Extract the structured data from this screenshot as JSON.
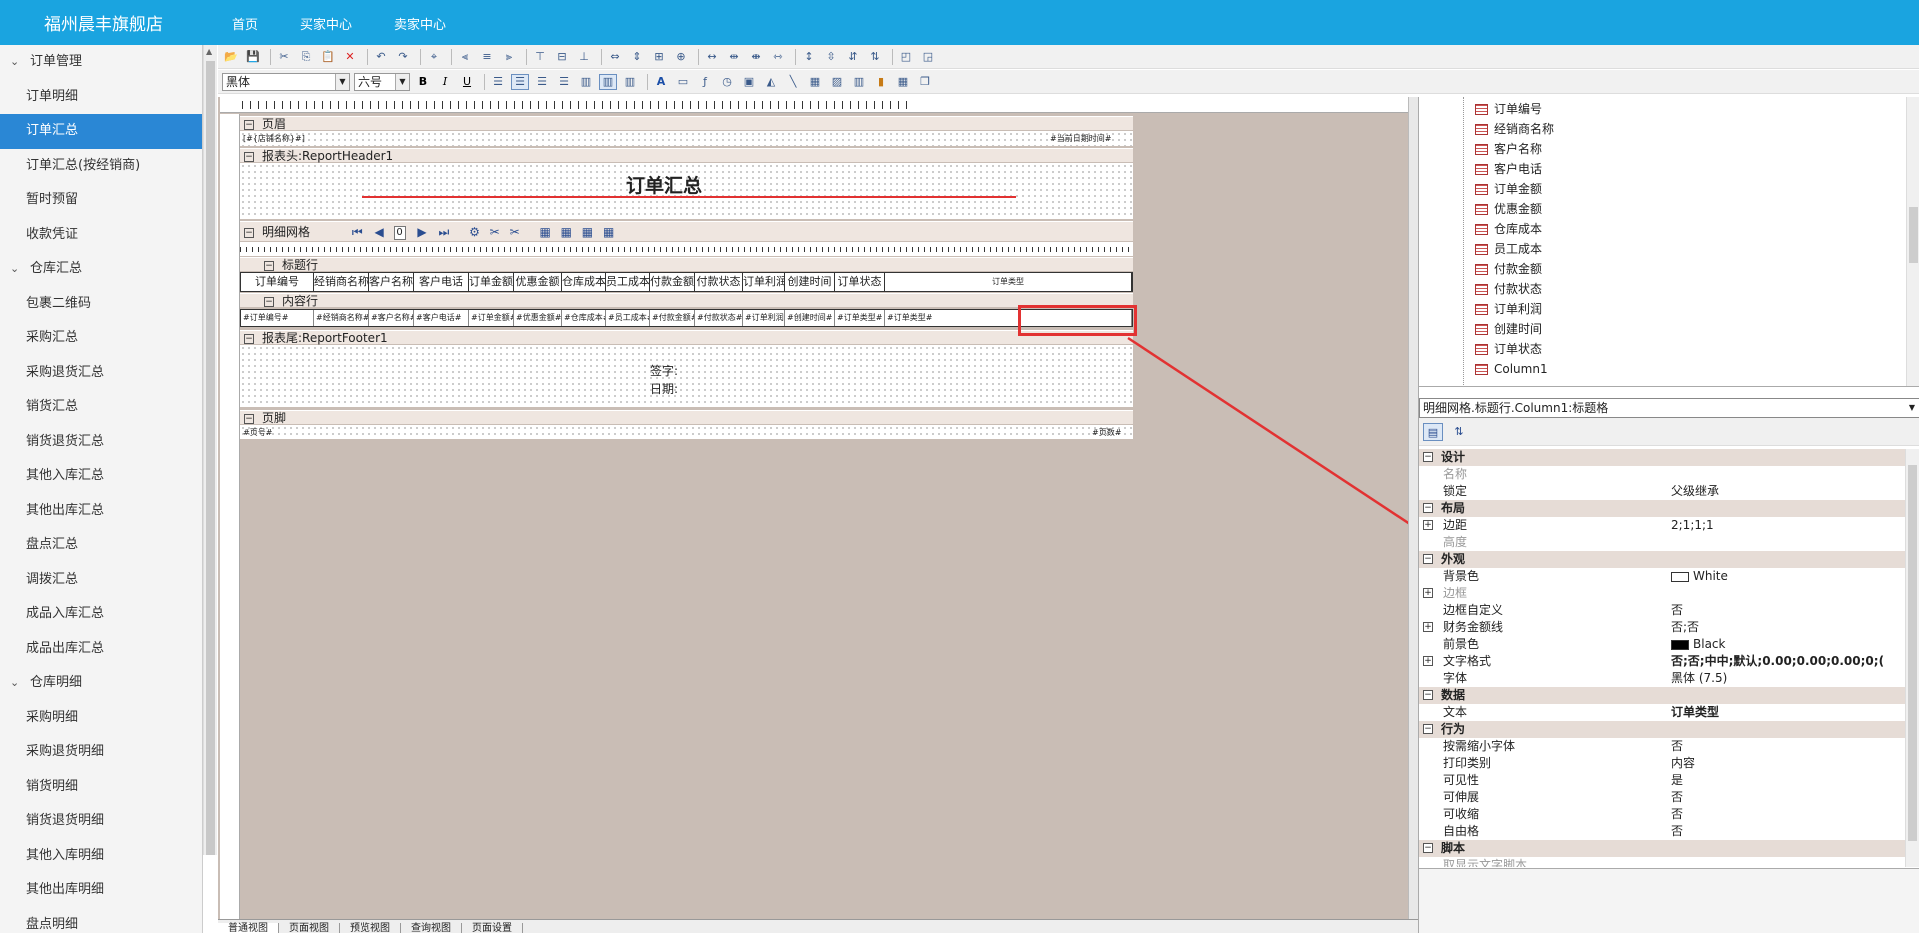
{
  "header": {
    "brand": "福州晨丰旗舰店",
    "nav": [
      "首页",
      "买家中心",
      "卖家中心"
    ]
  },
  "sidebar": {
    "items": [
      {
        "label": "订单管理",
        "group": true
      },
      {
        "label": "订单明细"
      },
      {
        "label": "订单汇总",
        "active": true
      },
      {
        "label": "订单汇总(按经销商)"
      },
      {
        "label": "暂时预留"
      },
      {
        "label": "收款凭证"
      },
      {
        "label": "仓库汇总",
        "group": true
      },
      {
        "label": "包裹二维码"
      },
      {
        "label": "采购汇总"
      },
      {
        "label": "采购退货汇总"
      },
      {
        "label": "销货汇总"
      },
      {
        "label": "销货退货汇总"
      },
      {
        "label": "其他入库汇总"
      },
      {
        "label": "其他出库汇总"
      },
      {
        "label": "盘点汇总"
      },
      {
        "label": "调拨汇总"
      },
      {
        "label": "成品入库汇总"
      },
      {
        "label": "成品出库汇总"
      },
      {
        "label": "仓库明细",
        "group": true
      },
      {
        "label": "采购明细"
      },
      {
        "label": "采购退货明细"
      },
      {
        "label": "销货明细"
      },
      {
        "label": "销货退货明细"
      },
      {
        "label": "其他入库明细"
      },
      {
        "label": "其他出库明细"
      },
      {
        "label": "盘点明细"
      }
    ]
  },
  "toolbar": {
    "font_name": "黑体",
    "font_size": "六号"
  },
  "report": {
    "page_header_label": "页眉",
    "store_field": "[#{店铺名称}#]",
    "date_field": "#当前日期时间#",
    "report_header_label": "报表头:ReportHeader1",
    "title": "订单汇总",
    "detail_grid_label": "明细网格",
    "nav_page": "0",
    "title_row_label": "标题行",
    "content_row_label": "内容行",
    "report_footer_label": "报表尾:ReportFooter1",
    "sign_label": "签字:",
    "date_label": "日期:",
    "page_footer_label": "页脚",
    "page_no_field": "#页号#",
    "page_count_field": "#页数#",
    "columns": [
      "订单编号",
      "经销商名称",
      "客户名称",
      "客户电话",
      "订单金额",
      "优惠金额",
      "仓库成本",
      "员工成本",
      "付款金额",
      "付款状态",
      "订单利润",
      "创建时间",
      "订单状态",
      "订单类型"
    ],
    "cells": [
      "#订单编号#",
      "#经销商名称#",
      "#客户名称#",
      "#客户电话#",
      "#订单金额#",
      "#优惠金额#",
      "#仓库成本#",
      "#员工成本#",
      "#付款金额#",
      "#付款状态#",
      "#订单利润#",
      "#创建时间#",
      "#订单类型#",
      "#订单类型#"
    ]
  },
  "tree": {
    "items": [
      "订单编号",
      "经销商名称",
      "客户名称",
      "客户电话",
      "订单金额",
      "优惠金额",
      "仓库成本",
      "员工成本",
      "付款金额",
      "付款状态",
      "订单利润",
      "创建时间",
      "订单状态",
      "Column1"
    ]
  },
  "properties": {
    "object_selector": "明细网格.标题行.Column1:标题格",
    "rows": [
      {
        "key": "设计",
        "cat": true
      },
      {
        "key": "名称",
        "val": "",
        "dim": true
      },
      {
        "key": "锁定",
        "val": "父级继承"
      },
      {
        "key": "布局",
        "cat": true
      },
      {
        "key": "边距",
        "val": "2;1;1;1",
        "expand": true
      },
      {
        "key": "高度",
        "val": "",
        "dim": true
      },
      {
        "key": "外观",
        "cat": true
      },
      {
        "key": "背景色",
        "val": "White",
        "swatch": "#ffffff"
      },
      {
        "key": "边框",
        "val": "",
        "expand": true,
        "dim": true
      },
      {
        "key": "边框自定义",
        "val": "否"
      },
      {
        "key": "财务金额线",
        "val": "否;否",
        "expand": true
      },
      {
        "key": "前景色",
        "val": "Black",
        "swatch": "#000000"
      },
      {
        "key": "文字格式",
        "val": "否;否;中中;默认;0.00;0.00;0.00;0;(",
        "expand": true,
        "bold": true
      },
      {
        "key": "字体",
        "val": "黑体 (7.5)"
      },
      {
        "key": "数据",
        "cat": true
      },
      {
        "key": "文本",
        "val": "订单类型",
        "bold": true
      },
      {
        "key": "行为",
        "cat": true
      },
      {
        "key": "按需缩小字体",
        "val": "否"
      },
      {
        "key": "打印类别",
        "val": "内容"
      },
      {
        "key": "可见性",
        "val": "是"
      },
      {
        "key": "可伸展",
        "val": "否"
      },
      {
        "key": "可收缩",
        "val": "否"
      },
      {
        "key": "自由格",
        "val": "否"
      },
      {
        "key": "脚本",
        "cat": true
      },
      {
        "key": "取显示文字脚本",
        "val": "",
        "dim": true
      }
    ]
  },
  "bottom_tabs": [
    "普通视图",
    "页面视图",
    "预览视图",
    "查询视图",
    "页面设置"
  ],
  "colors": {
    "accent": "#1aa4e0",
    "active": "#2a87d5",
    "highlight": "#e23232"
  }
}
